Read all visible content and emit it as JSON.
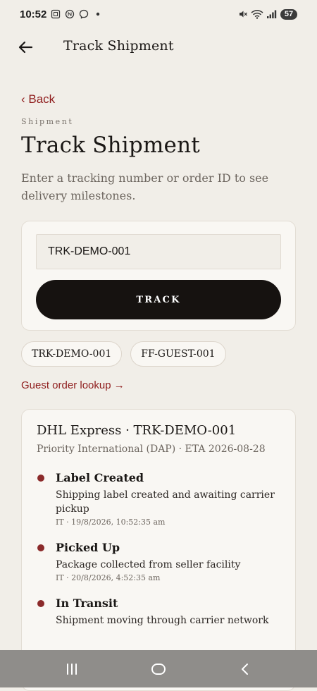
{
  "status_bar": {
    "time": "10:52",
    "battery": "57",
    "left_icons": [
      "screenshot-icon",
      "nfc-icon",
      "messenger-icon",
      "dot-icon"
    ],
    "right_icons": [
      "mute-icon",
      "wifi-icon",
      "signal-icon"
    ]
  },
  "app_bar": {
    "title": "Track Shipment"
  },
  "page": {
    "back_link": "‹ Back",
    "eyebrow": "Shipment",
    "title": "Track Shipment",
    "subtitle": "Enter a tracking number or order ID to see delivery milestones."
  },
  "search": {
    "value": "TRK-DEMO-001",
    "button_label": "TRACK"
  },
  "chips": [
    "TRK-DEMO-001",
    "FF-GUEST-001"
  ],
  "guest_link": "Guest order lookup →",
  "result": {
    "carrier_line": "DHL Express · TRK-DEMO-001",
    "service_line": "Priority International (DAP) · ETA 2026-08-28",
    "milestones": [
      {
        "title": "Label Created",
        "description": "Shipping label created and awaiting carrier pickup",
        "meta": "IT · 19/8/2026, 10:52:35 am"
      },
      {
        "title": "Picked Up",
        "description": "Package collected from seller facility",
        "meta": "IT · 20/8/2026, 4:52:35 am"
      },
      {
        "title": "In Transit",
        "description": "Shipment moving through carrier network",
        "meta": ""
      }
    ]
  },
  "colors": {
    "background": "#f1eee8",
    "accent": "#8f1d1d",
    "button": "#161210",
    "milestone_dot": "#8b2a2a",
    "nav_bar": "#8f8d8a"
  },
  "nav": {
    "icons": [
      "recent-apps-icon",
      "home-icon",
      "back-icon"
    ]
  }
}
